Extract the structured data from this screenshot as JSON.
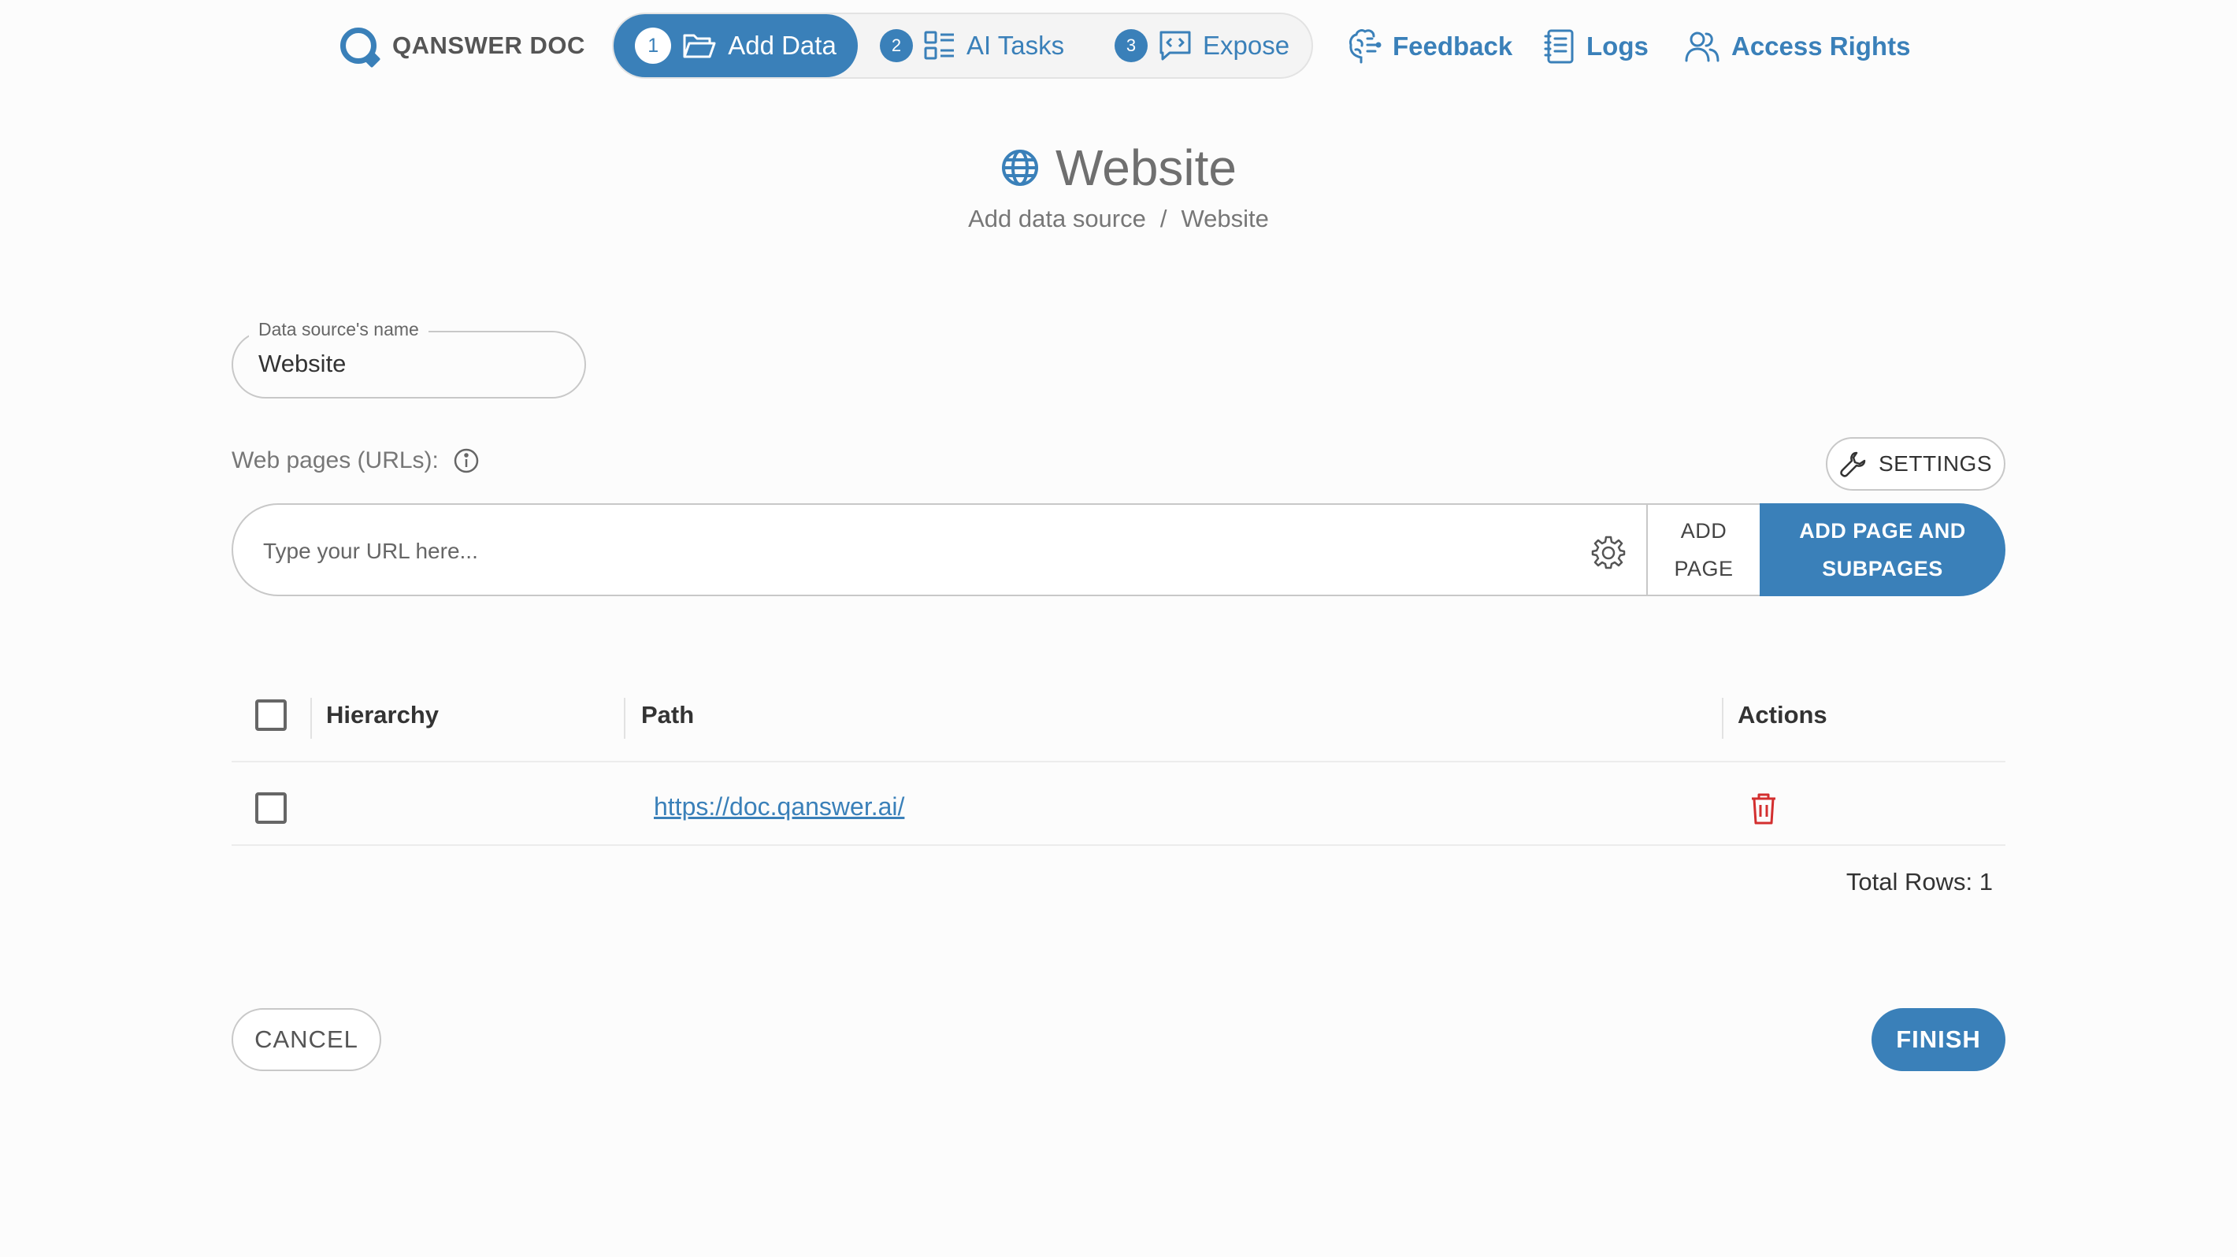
{
  "app": {
    "brand": "QANSWER DOC"
  },
  "stepper": [
    {
      "num": "1",
      "label": "Add Data",
      "icon": "folder-open-icon"
    },
    {
      "num": "2",
      "label": "AI Tasks",
      "icon": "list-grid-icon"
    },
    {
      "num": "3",
      "label": "Expose",
      "icon": "code-chat-icon"
    }
  ],
  "nav": {
    "feedback": "Feedback",
    "logs": "Logs",
    "access_rights": "Access Rights"
  },
  "page": {
    "title": "Website",
    "title_icon": "globe-icon",
    "breadcrumb": [
      "Add data source",
      "/",
      "Website"
    ]
  },
  "form": {
    "name_label": "Data source's name",
    "name_value": "Website",
    "urls_label": "Web pages (URLs):",
    "settings_label": "SETTINGS",
    "url_placeholder": "Type your URL here...",
    "url_value": "",
    "add_page_line1": "ADD",
    "add_page_line2": "PAGE",
    "add_subpages_line1": "ADD PAGE AND",
    "add_subpages_line2": "SUBPAGES"
  },
  "table": {
    "columns": [
      "Hierarchy",
      "Path",
      "Actions"
    ],
    "rows": [
      {
        "hierarchy": "",
        "path": "https://doc.qanswer.ai/",
        "action": "delete"
      }
    ],
    "total_rows": "Total Rows: 1"
  },
  "footer": {
    "cancel": "CANCEL",
    "finish": "FINISH"
  },
  "colors": {
    "accent": "#3a80b9",
    "delete": "#d32f2f",
    "muted_text": "#777777"
  }
}
